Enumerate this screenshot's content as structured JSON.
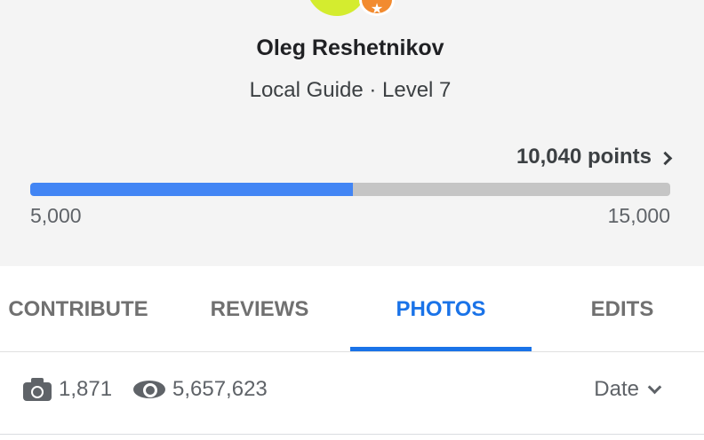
{
  "profile": {
    "name": "Oleg Reshetnikov",
    "subtitle": "Local Guide · Level 7",
    "avatar_icon": "avatar-image",
    "badge_icon": "star-badge-icon",
    "badge_symbol": "★"
  },
  "progress": {
    "points_label": "10,040 points",
    "min_label": "5,000",
    "max_label": "15,000",
    "current": 10040,
    "min": 5000,
    "max": 15000,
    "fill_color": "#4285f4",
    "track_color": "#c5c5c5"
  },
  "tabs": [
    {
      "label": "CONTRIBUTE",
      "active": false
    },
    {
      "label": "REVIEWS",
      "active": false
    },
    {
      "label": "PHOTOS",
      "active": true
    },
    {
      "label": "EDITS",
      "active": false
    }
  ],
  "stats": {
    "photos_count": "1,871",
    "views_count": "5,657,623"
  },
  "sort": {
    "label": "Date"
  },
  "colors": {
    "accent": "#1a73e8",
    "header_bg": "#f4f4f4",
    "badge": "#f28b30"
  }
}
